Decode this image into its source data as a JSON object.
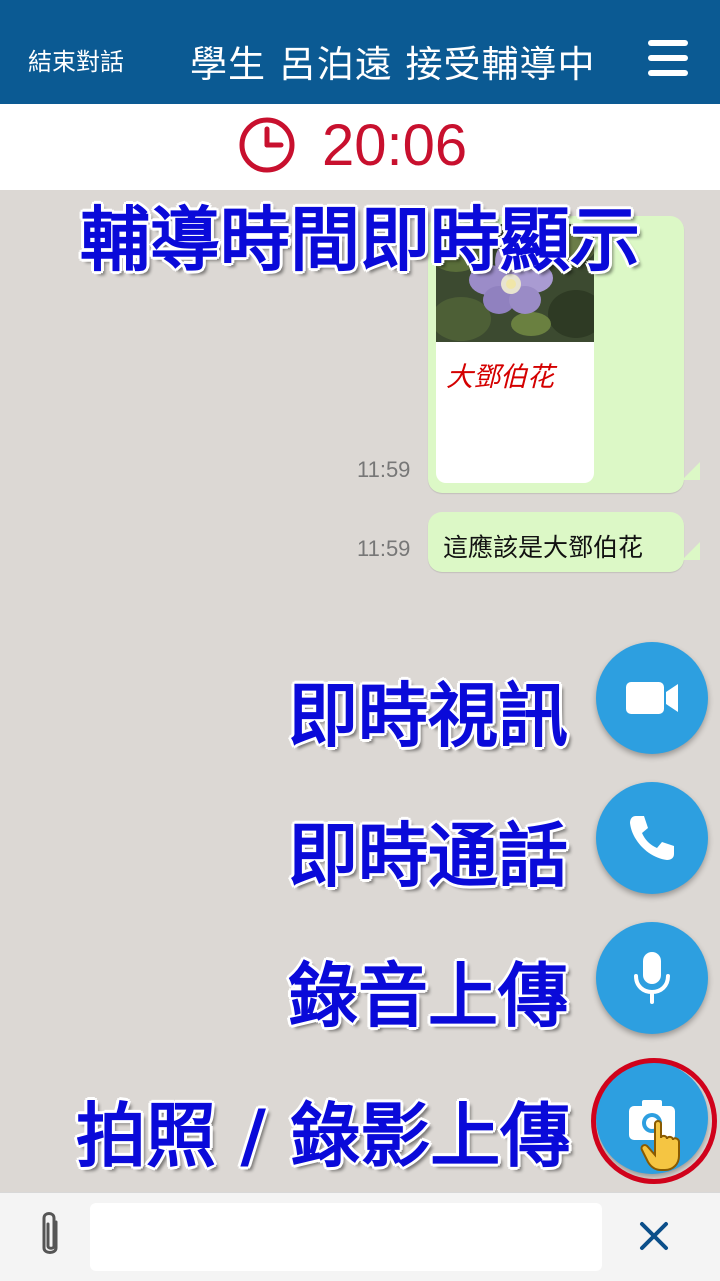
{
  "header": {
    "end_chat": "結束對話",
    "title": "學生 呂泊遠 接受輔導中"
  },
  "timer": {
    "value": "20:06"
  },
  "messages": [
    {
      "type": "image",
      "caption": "大鄧伯花",
      "time": "11:59"
    },
    {
      "type": "text",
      "text": "這應該是大鄧伯花",
      "time": "11:59"
    }
  ],
  "annotations": {
    "timer_note": "輔導時間即時顯示",
    "video_call": "即時視訊",
    "voice_call": "即時通話",
    "audio_upload": "錄音上傳",
    "photo_upload": "拍照 / 錄影上傳"
  },
  "composer": {
    "placeholder": ""
  },
  "colors": {
    "header_bg": "#0b5a93",
    "timer_red": "#c8102e",
    "bubble_green": "#dcf8c6",
    "fab_blue": "#2d9fe0",
    "overlay_blue": "#0a0ad9",
    "highlight_ring": "#d0021b",
    "close_x": "#0b4f8a"
  },
  "icons": [
    "hamburger-menu-icon",
    "clock-icon",
    "video-camera-icon",
    "phone-icon",
    "microphone-icon",
    "camera-icon",
    "pointing-hand-icon",
    "paperclip-icon",
    "close-icon"
  ]
}
